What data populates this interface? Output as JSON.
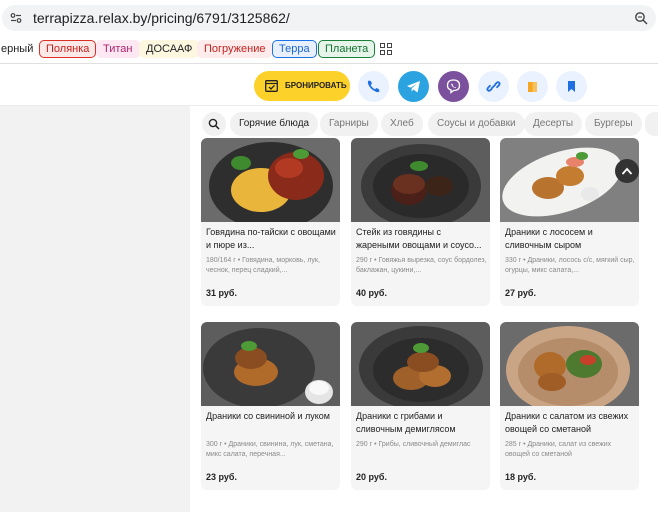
{
  "browser": {
    "url": "terrapizza.relax.by/pricing/6791/3125862/"
  },
  "bookmarks": [
    {
      "label": "ерный",
      "border": "",
      "color": "#202124",
      "bg": "#fff"
    },
    {
      "label": "Полянка",
      "border": "#d93025",
      "color": "#c5221f",
      "bg": "#fce8e6"
    },
    {
      "label": "Титан",
      "border": "",
      "color": "#b0236d",
      "bg": "#fde7f3"
    },
    {
      "label": "ДОСААФ",
      "border": "",
      "color": "#202124",
      "bg": "#fef7e0"
    },
    {
      "label": "Погружение",
      "border": "",
      "color": "#c5221f",
      "bg": "#fdeceb"
    },
    {
      "label": "Терра",
      "border": "#1a73e8",
      "color": "#1967d2",
      "bg": "#e8f0fe"
    },
    {
      "label": "Планета",
      "border": "#188038",
      "color": "#137333",
      "bg": "#e6f4ea"
    }
  ],
  "header": {
    "book_label": "БРОНИРОВАТЬ",
    "colors": {
      "accent": "#fcd12a",
      "telegram": "#2aa3e0",
      "viber": "#7b519d"
    }
  },
  "categories": [
    "Горячие блюда",
    "Гарниры",
    "Хлеб",
    "Соусы и добавки",
    "Десерты",
    "Бургеры"
  ],
  "products": [
    {
      "name": "Говядина по-тайски с овощами и пюре из...",
      "desc": "180/164 г • Говядина, морковь, лук, чеснок, перец сладкий,...",
      "price": "31 руб.",
      "plate": "#2e2e2e"
    },
    {
      "name": "Стейк из говядины с жареными овощами и соусо...",
      "desc": "290 г • Говяжья вырезка, соус бордолез, баклажан, цукини,...",
      "price": "40 руб.",
      "plate": "#3a3a3a"
    },
    {
      "name": "Драники с лососем и сливочным сыром",
      "desc": "330 г • Драники, лосось с/с, мягкий сыр, огурцы, микс салата,...",
      "price": "27 руб.",
      "plate": "#f2f2f0"
    },
    {
      "name": "Драники со свининой и луком",
      "desc": "300 г • Драники, свинина, лук, сметана, микс салата, перечная...",
      "price": "23 руб.",
      "plate": "#3a3a3a"
    },
    {
      "name": "Драники с грибами и сливочным демиглясом",
      "desc": "290 г • Грибы, сливочный демиглас",
      "price": "20 руб.",
      "plate": "#3a3a3a"
    },
    {
      "name": "Драники с салатом из свежих овощей со сметаной",
      "desc": "285 г • Драники, салат из свежих овощей со сметаной",
      "price": "18 руб.",
      "plate": "#c9a585"
    }
  ]
}
